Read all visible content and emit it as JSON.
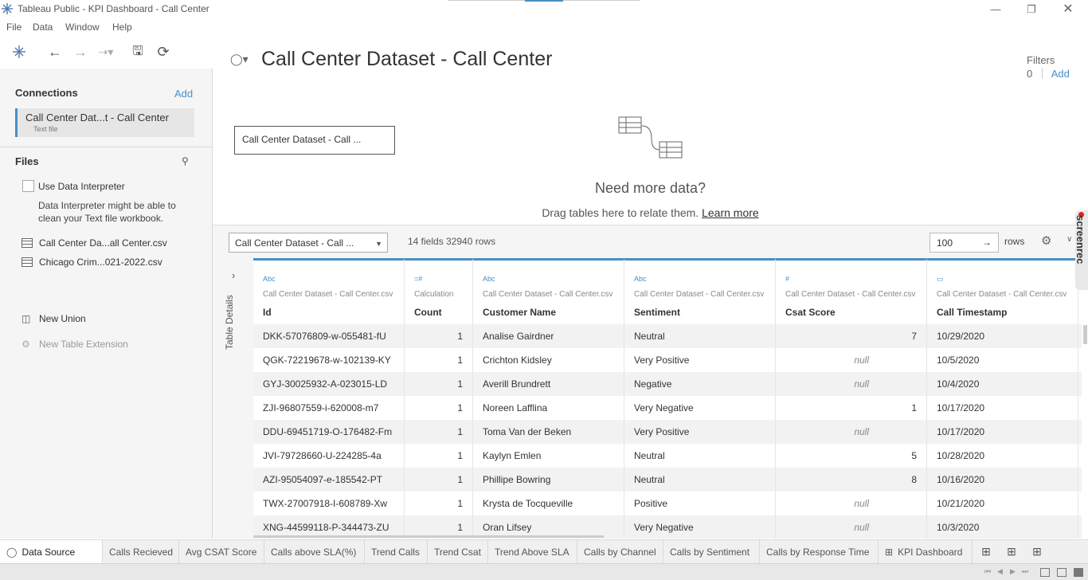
{
  "window": {
    "title": "Tableau Public - KPI Dashboard - Call Center"
  },
  "menu": [
    "File",
    "Data",
    "Window",
    "Help"
  ],
  "sidebar": {
    "connections_label": "Connections",
    "add_label": "Add",
    "connection": {
      "name": "Call Center Dat...t - Call Center",
      "type": "Text file"
    },
    "files_label": "Files",
    "use_interpreter": "Use Data Interpreter",
    "interpreter_hint_line1": "Data Interpreter might be able to",
    "interpreter_hint_line2": "clean your Text file workbook.",
    "files": [
      "Call Center Da...all Center.csv",
      "Chicago Crim...021-2022.csv"
    ],
    "new_union": "New Union",
    "new_table_extension": "New Table Extension"
  },
  "datasource": {
    "title": "Call Center Dataset - Call Center",
    "filters_label": "Filters",
    "filters_count": "0",
    "filters_add": "Add",
    "canvas_table": "Call Center Dataset - Call ...",
    "need_more": "Need more data?",
    "drag_text": "Drag tables here to relate them.",
    "learn_more": "Learn more"
  },
  "gridbar": {
    "table_select": "Call Center Dataset - Call ...",
    "fields_info": "14 fields 32940 rows",
    "rows_value": "100",
    "rows_label": "rows"
  },
  "table_details": "Table Details",
  "columns": [
    {
      "type_icon": "Abc",
      "source": "Call Center Dataset - Call Center.csv",
      "name": "Id"
    },
    {
      "type_icon": "=#",
      "source": "Calculation",
      "name": "Count"
    },
    {
      "type_icon": "Abc",
      "source": "Call Center Dataset - Call Center.csv",
      "name": "Customer Name"
    },
    {
      "type_icon": "Abc",
      "source": "Call Center Dataset - Call Center.csv",
      "name": "Sentiment"
    },
    {
      "type_icon": "#",
      "source": "Call Center Dataset - Call Center.csv",
      "name": "Csat Score"
    },
    {
      "type_icon": "▭",
      "source": "Call Center Dataset - Call Center.csv",
      "name": "Call Timestamp"
    }
  ],
  "rows": [
    [
      "DKK-57076809-w-055481-fU",
      "1",
      "Analise Gairdner",
      "Neutral",
      "7",
      "10/29/2020"
    ],
    [
      "QGK-72219678-w-102139-KY",
      "1",
      "Crichton Kidsley",
      "Very Positive",
      "null",
      "10/5/2020"
    ],
    [
      "GYJ-30025932-A-023015-LD",
      "1",
      "Averill Brundrett",
      "Negative",
      "null",
      "10/4/2020"
    ],
    [
      "ZJI-96807559-i-620008-m7",
      "1",
      "Noreen Lafflina",
      "Very Negative",
      "1",
      "10/17/2020"
    ],
    [
      "DDU-69451719-O-176482-Fm",
      "1",
      "Toma Van der Beken",
      "Very Positive",
      "null",
      "10/17/2020"
    ],
    [
      "JVI-79728660-U-224285-4a",
      "1",
      "Kaylyn Emlen",
      "Neutral",
      "5",
      "10/28/2020"
    ],
    [
      "AZI-95054097-e-185542-PT",
      "1",
      "Phillipe Bowring",
      "Neutral",
      "8",
      "10/16/2020"
    ],
    [
      "TWX-27007918-I-608789-Xw",
      "1",
      "Krysta de Tocqueville",
      "Positive",
      "null",
      "10/21/2020"
    ],
    [
      "XNG-44599118-P-344473-ZU",
      "1",
      "Oran Lifsey",
      "Very Negative",
      "null",
      "10/3/2020"
    ]
  ],
  "tabs": [
    "Data Source",
    "Calls Recieved",
    "Avg CSAT Score",
    "Calls above SLA(%)",
    "Trend Calls",
    "Trend Csat",
    "Trend Above SLA",
    "Calls by Channel",
    "Calls by Sentiment",
    "Calls by Response Time",
    "KPI Dashboard"
  ],
  "watermark": "screenrec",
  "colors": {
    "accent": "#4a8fc4",
    "sidebar_bg": "#f5f5f5"
  }
}
